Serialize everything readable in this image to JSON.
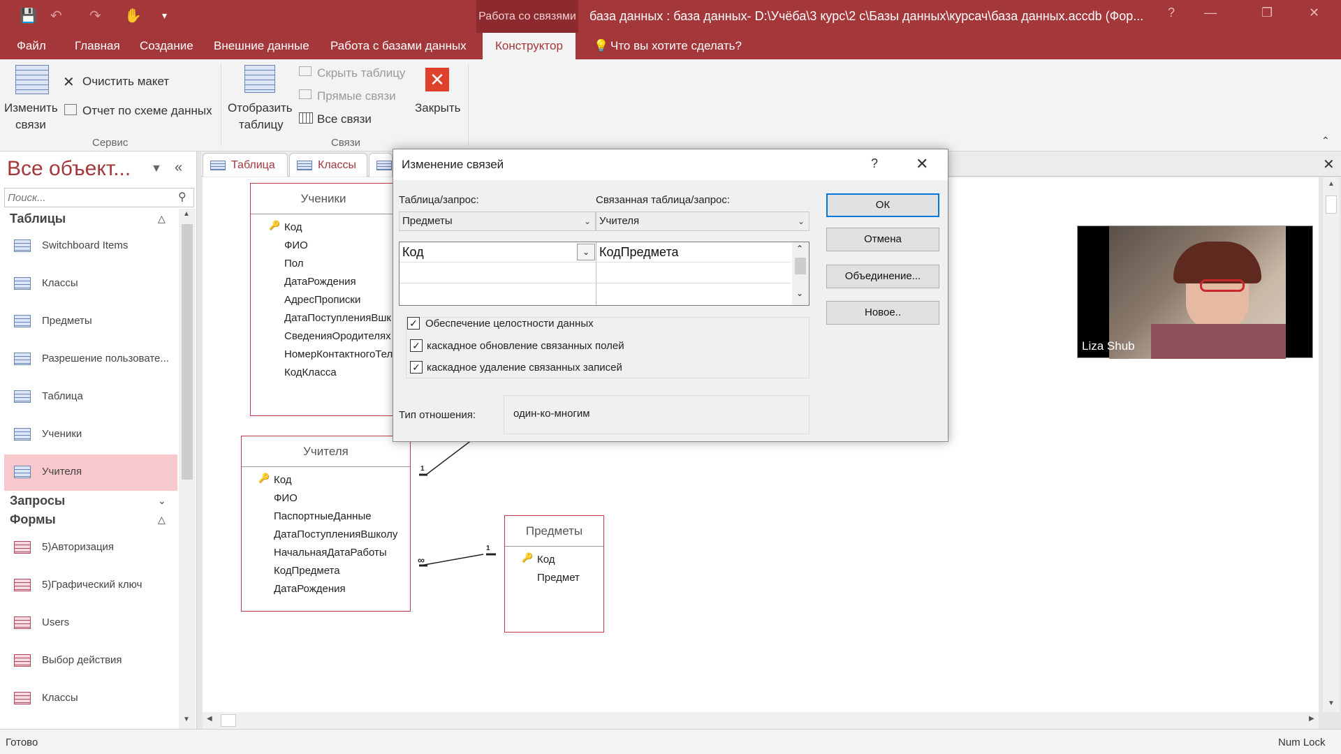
{
  "titlebar": {
    "context_tab": "Работа со связями",
    "doc_title": "база данных : база данных- D:\\Учёба\\3 курс\\2 с\\Базы данных\\курсач\\база данных.accdb (Фор...",
    "help": "?"
  },
  "menu": {
    "file": "Файл",
    "home": "Главная",
    "create": "Создание",
    "external": "Внешние данные",
    "dbtools": "Работа с базами данных",
    "design": "Конструктор",
    "tellme": "Что вы хотите сделать?"
  },
  "ribbon": {
    "edit_rel_1": "Изменить",
    "edit_rel_2": "связи",
    "clear_layout": "Очистить макет",
    "report": "Отчет по схеме данных",
    "group_tools": "Сервис",
    "show_table_1": "Отобразить",
    "show_table_2": "таблицу",
    "hide_table": "Скрыть таблицу",
    "direct_rel": "Прямые связи",
    "all_rel": "Все связи",
    "close": "Закрыть",
    "group_rel": "Связи"
  },
  "nav": {
    "title": "Все объект...",
    "search_placeholder": "Поиск...",
    "cat_tables": "Таблицы",
    "tables": [
      "Switchboard Items",
      "Классы",
      "Предметы",
      "Разрешение пользовате...",
      "Таблица",
      "Ученики",
      "Учителя"
    ],
    "cat_queries": "Запросы",
    "cat_forms": "Формы",
    "forms": [
      "5)Авторизация",
      "5)Графический ключ",
      "Users",
      "Выбор действия",
      "Классы"
    ]
  },
  "tabs": [
    "Таблица",
    "Классы"
  ],
  "schema": {
    "students": {
      "title": "Ученики",
      "fields": [
        "Код",
        "ФИО",
        "Пол",
        "ДатаРождения",
        "АдресПрописки",
        "ДатаПоступленияВшк",
        "СведенияОродителях",
        "НомерКонтактногоТел",
        "КодКласса"
      ]
    },
    "teachers": {
      "title": "Учителя",
      "fields": [
        "Код",
        "ФИО",
        "ПаспортныеДанные",
        "ДатаПоступленияВшколу",
        "НачальнаяДатаРаботы",
        "КодПредмета",
        "ДатаРождения"
      ]
    },
    "subjects": {
      "title": "Предметы",
      "fields": [
        "Код",
        "Предмет"
      ]
    },
    "rel_one": "1",
    "rel_many": "∞"
  },
  "dialog": {
    "title": "Изменение связей",
    "help": "?",
    "label_table": "Таблица/запрос:",
    "label_related": "Связанная таблица/запрос:",
    "table_value": "Предметы",
    "related_value": "Учителя",
    "grid_left": "Код",
    "grid_right": "КодПредмета",
    "chk_integrity": "Обеспечение целостности данных",
    "chk_cascade_update": "каскадное обновление связанных полей",
    "chk_cascade_delete": "каскадное удаление связанных записей",
    "integrity_checked": true,
    "cascade_update_checked": true,
    "cascade_delete_checked": true,
    "label_type": "Тип отношения:",
    "type_value": "один-ко-многим",
    "btn_ok": "ОК",
    "btn_cancel": "Отмена",
    "btn_join": "Объединение...",
    "btn_new": "Новое.."
  },
  "video": {
    "name": "Liza Shub"
  },
  "status": {
    "left": "Готово",
    "right": "Num Lock"
  },
  "colors": {
    "accent": "#a4373a",
    "selection": "#f7c8cc"
  }
}
